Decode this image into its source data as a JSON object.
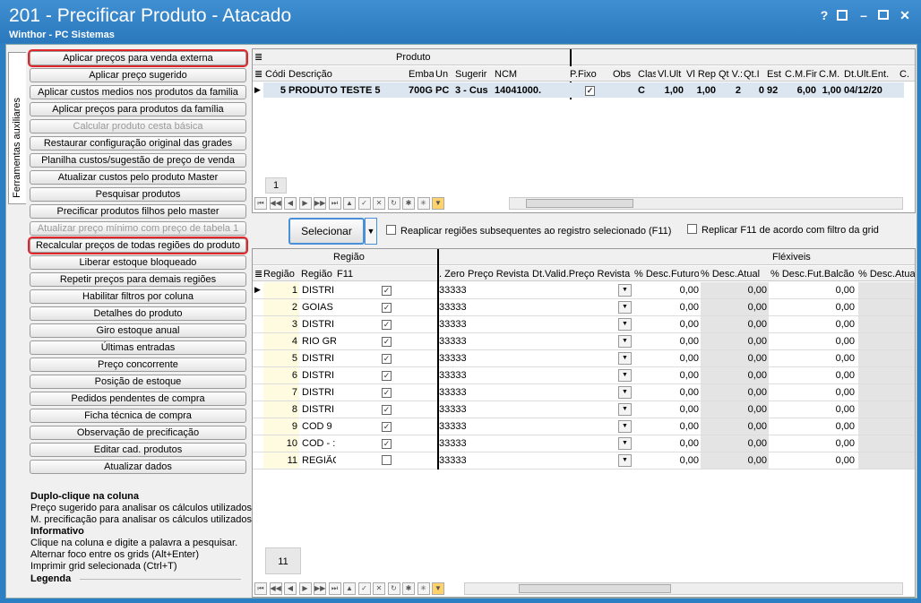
{
  "window": {
    "title": "201 - Precificar Produto - Atacado",
    "subtitle": "Winthor - PC Sistemas",
    "help_btn": "?",
    "min_btn": "–",
    "close_btn": "✕"
  },
  "side_tab": "Ferramentas auxiliares",
  "tools": [
    "Aplicar preços para venda externa",
    "Aplicar preço sugerido",
    "Aplicar custos medios nos produtos da familia",
    "Aplicar preços para produtos da família",
    "Calcular produto cesta básica",
    "Restaurar configuração original das grades",
    "Planilha custos/sugestão de preço de venda",
    "Atualizar custos pelo produto Master",
    "Pesquisar produtos",
    "Precificar produtos filhos pelo master",
    "Atualizar preço mínimo com preço de tabela 1",
    "Recalcular preços de todas regiões do produto",
    "Liberar estoque bloqueado",
    "Repetir preços para demais regiões",
    "Habilitar filtros por coluna",
    "Detalhes do produto",
    "Giro estoque anual",
    "Últimas entradas",
    "Preço concorrente",
    "Posição de estoque",
    "Pedidos pendentes de compra",
    "Ficha técnica de compra",
    "Observação de precificação",
    "Editar cad. produtos",
    "Atualizar dados"
  ],
  "help": {
    "h1": "Duplo-clique na coluna",
    "l1": "Preço sugerido para analisar os cálculos utilizados.",
    "l2": "M. precificação para analisar os cálculos utilizados.",
    "h2": "Informativo",
    "l3": "Clique na coluna e digite a palavra a pesquisar.",
    "l4": "Alternar foco entre os grids (Alt+Enter)",
    "l5": "Imprimir grid selecionada (Ctrl+T)",
    "h3": "Legenda"
  },
  "product_grid": {
    "group": "Produto",
    "columns": [
      "Códi",
      "Descrição",
      "Emba",
      "Un",
      "Sugerir",
      "NCM",
      "P.Fixo",
      "Obs",
      "Clas",
      "Vl.Ult",
      "Vl Rep",
      "Qt V.:",
      "Qt.I",
      "Est",
      "C.M.Fin",
      "C.M.",
      "Dt.Ult.Ent.",
      "C."
    ],
    "row": [
      "5",
      "PRODUTO TESTE 5",
      "700G",
      "PC",
      "3 - Cus",
      "14041000.",
      "✓",
      "",
      "C",
      "1,00",
      "1,00",
      "2",
      "0",
      "92",
      "6,00",
      "1,00",
      "04/12/20",
      ""
    ],
    "count": "1"
  },
  "selecionar": "Selecionar",
  "opt1": "Reaplicar regiões subsequentes ao registro selecionado (F11)",
  "opt2": "Replicar F11 de acordo com filtro da grid",
  "region_grid": {
    "group_regiao": "Região",
    "group_flex": "Fléxiveis",
    "columns": [
      "Região",
      "Região",
      "F11",
      ". Zero",
      "Preço Revista",
      "Dt.Valid.Preço Revista",
      "% Desc.Futuro",
      "% Desc.Atual",
      "% Desc.Fut.Balcão",
      "% Desc.Atua"
    ],
    "rows": [
      {
        "n": "1",
        "name": "DISTRI",
        "f11": true,
        "zero": "33333",
        "fut": "0,00",
        "atual": "0,00",
        "balc": "0,00"
      },
      {
        "n": "2",
        "name": "GOIAS",
        "f11": true,
        "zero": "33333",
        "fut": "0,00",
        "atual": "0,00",
        "balc": "0,00"
      },
      {
        "n": "3",
        "name": "DISTRI",
        "f11": true,
        "zero": "33333",
        "fut": "0,00",
        "atual": "0,00",
        "balc": "0,00"
      },
      {
        "n": "4",
        "name": "RIO GR",
        "f11": true,
        "zero": "33333",
        "fut": "0,00",
        "atual": "0,00",
        "balc": "0,00"
      },
      {
        "n": "5",
        "name": "DISTRI",
        "f11": true,
        "zero": "33333",
        "fut": "0,00",
        "atual": "0,00",
        "balc": "0,00"
      },
      {
        "n": "6",
        "name": "DISTRI",
        "f11": true,
        "zero": "33333",
        "fut": "0,00",
        "atual": "0,00",
        "balc": "0,00"
      },
      {
        "n": "7",
        "name": "DISTRI",
        "f11": true,
        "zero": "33333",
        "fut": "0,00",
        "atual": "0,00",
        "balc": "0,00"
      },
      {
        "n": "8",
        "name": "DISTRI",
        "f11": true,
        "zero": "33333",
        "fut": "0,00",
        "atual": "0,00",
        "balc": "0,00"
      },
      {
        "n": "9",
        "name": "COD 9",
        "f11": true,
        "zero": "33333",
        "fut": "0,00",
        "atual": "0,00",
        "balc": "0,00"
      },
      {
        "n": "10",
        "name": "COD - :",
        "f11": true,
        "zero": "33333",
        "fut": "0,00",
        "atual": "0,00",
        "balc": "0,00"
      },
      {
        "n": "11",
        "name": "REGIÃC",
        "f11": false,
        "zero": "33333",
        "fut": "0,00",
        "atual": "0,00",
        "balc": "0,00"
      }
    ],
    "count": "11"
  },
  "nav_glyphs": [
    "⏮",
    "◀◀",
    "◀",
    "▶",
    "▶▶",
    "⏭",
    "▲",
    "✓",
    "✕",
    "↻",
    "✱",
    "✳",
    "▼"
  ]
}
